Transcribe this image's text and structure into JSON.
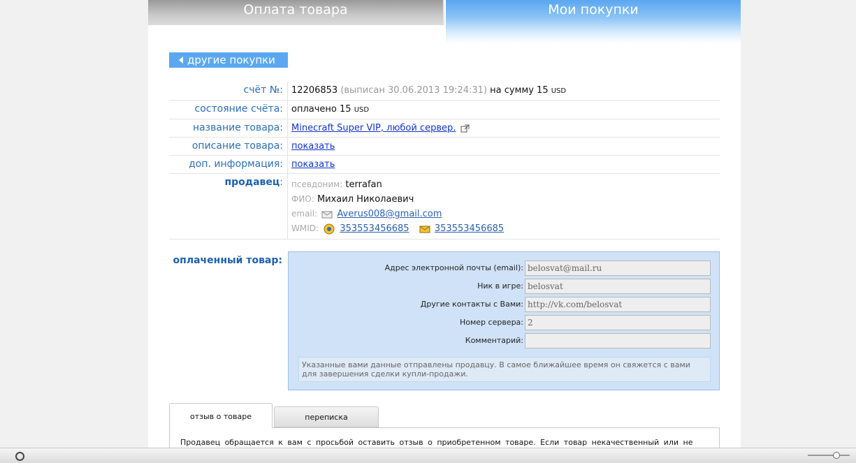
{
  "tabs": {
    "pay": "Оплата товара",
    "my": "Мои покупки"
  },
  "back_button": "другие покупки",
  "invoice": {
    "label": "счёт №:",
    "number": "12206853",
    "issued": "(выписан 30.06.2013 19:24:31)",
    "sum_prefix": "на сумму 15",
    "currency": "USD"
  },
  "status": {
    "label": "состояние счёта:",
    "value": "оплачено 15",
    "currency": "USD"
  },
  "product_name": {
    "label": "название товара:",
    "value": "Minecraft Super VIP, любой сервер."
  },
  "product_description": {
    "label": "описание товара:",
    "link": "показать"
  },
  "additional_info": {
    "label": "доп. информация:",
    "link": "показать"
  },
  "seller": {
    "label": "продавец",
    "nick_label": "псевдоним:",
    "nick": "terrafan",
    "fio_label": "ФИО:",
    "fio": "Михаил Николаевич",
    "email_label": "email:",
    "email": "Averus008@gmail.com",
    "wmid_label": "WMID:",
    "wmid_1": "353553456685",
    "wmid_2": "353553456685"
  },
  "paid": {
    "label": "оплаченный товар:",
    "fields": [
      {
        "label": "Адрес электронной почты (email):",
        "value": "belosvat@mail.ru"
      },
      {
        "label": "Ник в игре:",
        "value": "belosvat"
      },
      {
        "label": "Другие контакты с Вами:",
        "value": "http://vk.com/belosvat"
      },
      {
        "label": "Номер сервера:",
        "value": "2"
      },
      {
        "label": "Комментарий:",
        "value": ""
      }
    ],
    "note": "Указанные вами данные отправлены продавцу. В самое ближайшее время он свяжется с вами для завершения сделки купли-продажи."
  },
  "review_tabs": {
    "review": "отзыв о товаре",
    "correspondence": "переписка",
    "body": "Продавец обращается к вам с просьбой оставить отзыв о приобретенном товаре. Если товар некачественный или не"
  },
  "colors": {
    "accent": "#5ba8f0",
    "label_blue": "#2a6fb8",
    "panel": "#cfe2f7"
  }
}
